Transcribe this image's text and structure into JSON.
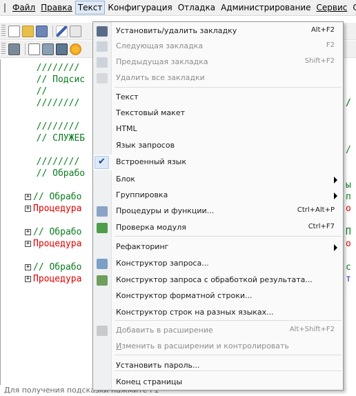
{
  "menubar": {
    "items": [
      "Файл",
      "Правка",
      "Текст",
      "Конфигурация",
      "Отладка",
      "Администрирование",
      "Сервис",
      "С"
    ],
    "active_index": 2
  },
  "code_lines": [
    {
      "text": "  ////////",
      "color": "green"
    },
    {
      "text": "  // Подсис",
      "color": "green"
    },
    {
      "text": "  //",
      "color": "green"
    },
    {
      "text": "  ////////",
      "color": "green"
    },
    {
      "text": "",
      "color": "green"
    },
    {
      "text": "  ////////",
      "color": "green"
    },
    {
      "text": "  // СЛУЖЕБ",
      "color": "green"
    },
    {
      "text": "",
      "color": "green"
    },
    {
      "text": "  ////////",
      "color": "green"
    },
    {
      "text": "  // Обрабо",
      "color": "green"
    },
    {
      "text": "",
      "color": "green"
    },
    {
      "text": "// Обрабо",
      "color": "green",
      "fold": true
    },
    {
      "text": "Процедура",
      "color": "red",
      "fold": true
    },
    {
      "text": "",
      "color": "green"
    },
    {
      "text": "// Обрабо",
      "color": "green",
      "fold": true
    },
    {
      "text": "Процедура",
      "color": "red",
      "fold": true
    },
    {
      "text": "",
      "color": "green"
    },
    {
      "text": "// Обрабо",
      "color": "green",
      "fold": true
    },
    {
      "text": "Процедура",
      "color": "red",
      "fold": true
    }
  ],
  "right_fragments": [
    "/",
    "/",
    "/",
    "ы",
    "п",
    "о",
    "П",
    "о",
    "с",
    "т"
  ],
  "dropdown": {
    "items": [
      {
        "label": "Установить/удалить закладку",
        "shortcut": "Alt+F2",
        "icon": "bookmark-toggle-icon",
        "disabled": false
      },
      {
        "label": "Следующая закладка",
        "shortcut": "F2",
        "icon": "bookmark-next-icon",
        "disabled": true
      },
      {
        "label": "Предыдущая закладка",
        "shortcut": "Shift+F2",
        "icon": "bookmark-prev-icon",
        "disabled": true
      },
      {
        "label": "Удалить все закладки",
        "shortcut": "",
        "icon": "bookmark-clear-icon",
        "disabled": true
      },
      {
        "label": "Текст",
        "shortcut": "",
        "icon": "",
        "disabled": false
      },
      {
        "label": "Текстовый макет",
        "shortcut": "",
        "icon": "",
        "disabled": false
      },
      {
        "label": "HTML",
        "shortcut": "",
        "icon": "",
        "disabled": false
      },
      {
        "label": "Язык запросов",
        "shortcut": "",
        "icon": "",
        "disabled": false
      },
      {
        "label": "Встроенный язык",
        "shortcut": "",
        "icon": "check-icon",
        "disabled": false,
        "checked": true
      },
      {
        "label": "Блок",
        "shortcut": "",
        "icon": "",
        "disabled": false,
        "submenu": true
      },
      {
        "label": "Группировка",
        "shortcut": "",
        "icon": "",
        "disabled": false,
        "submenu": true
      },
      {
        "label": "Процедуры и функции...",
        "shortcut": "Ctrl+Alt+P",
        "icon": "procedures-icon",
        "disabled": false
      },
      {
        "label": "Проверка модуля",
        "shortcut": "Ctrl+F7",
        "icon": "module-check-icon",
        "disabled": false
      },
      {
        "label": "Рефакторинг",
        "shortcut": "",
        "icon": "",
        "disabled": false,
        "submenu": true
      },
      {
        "label": "Конструктор запроса...",
        "shortcut": "",
        "icon": "query-builder-icon",
        "disabled": false
      },
      {
        "label": "Конструктор запроса с обработкой результата...",
        "shortcut": "",
        "icon": "query-builder-result-icon",
        "disabled": false
      },
      {
        "label": "Конструктор форматной строки...",
        "shortcut": "",
        "icon": "",
        "disabled": false
      },
      {
        "label": "Конструктор строк на разных языках...",
        "shortcut": "",
        "icon": "",
        "disabled": false
      },
      {
        "label": "Добавить в расширение",
        "shortcut": "Alt+Shift+F2",
        "icon": "extension-add-icon",
        "disabled": true
      },
      {
        "label": "Изменить в расширении и контролировать",
        "shortcut": "",
        "icon": "",
        "disabled": true
      },
      {
        "label": "Установить пароль...",
        "shortcut": "",
        "icon": "",
        "disabled": false
      },
      {
        "label": "Конец страницы",
        "shortcut": "",
        "icon": "",
        "disabled": false
      }
    ]
  },
  "status_text": "Для получения подсказки нажмите F1",
  "colors": {
    "comment": "#0a7c1e",
    "keyword": "#e00000",
    "menu_highlight": "#dfe9f5"
  }
}
